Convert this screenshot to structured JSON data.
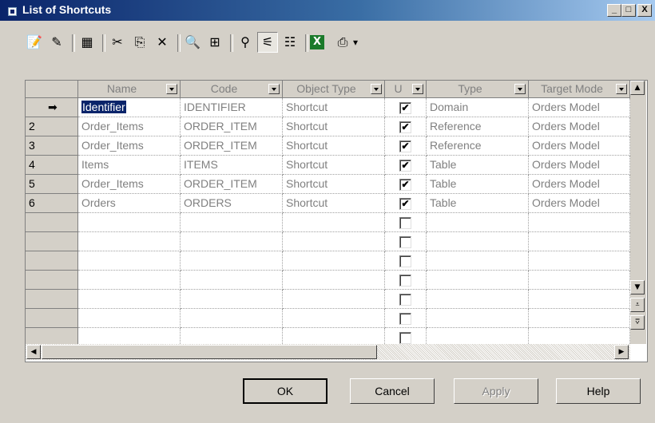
{
  "window": {
    "title": "List of Shortcuts",
    "controls": {
      "minimize": "_",
      "maximize": "□",
      "close": "X"
    }
  },
  "toolbar": [
    {
      "name": "properties-icon",
      "glyph": "📝"
    },
    {
      "name": "edit-icon",
      "glyph": "✎"
    },
    {
      "name": "insert-row-icon",
      "glyph": "▦"
    },
    {
      "name": "cut-icon",
      "glyph": "✂"
    },
    {
      "name": "copy-icon",
      "glyph": "⎘"
    },
    {
      "name": "delete-icon",
      "glyph": "✕"
    },
    {
      "name": "find-icon",
      "glyph": "🔍"
    },
    {
      "name": "find-in-diagram-icon",
      "glyph": "⊞"
    },
    {
      "name": "filter-icon",
      "glyph": "⚲"
    },
    {
      "name": "enable-filter-icon",
      "glyph": "⚟"
    },
    {
      "name": "customize-columns-icon",
      "glyph": "☷"
    },
    {
      "name": "export-excel-icon",
      "glyph": "X"
    },
    {
      "name": "print-icon",
      "glyph": "⎙"
    },
    {
      "name": "print-dropdown-icon",
      "glyph": "▾"
    }
  ],
  "grid": {
    "columns": [
      "Name",
      "Code",
      "Object Type",
      "U",
      "Type",
      "Target Mode"
    ],
    "rows": [
      {
        "num": "",
        "name": "Identifier",
        "code": "IDENTIFIER",
        "object_type": "Shortcut",
        "checked": true,
        "type": "Domain",
        "target_model": "Orders Model"
      },
      {
        "num": "2",
        "name": "Order_Items",
        "code": "ORDER_ITEM",
        "object_type": "Shortcut",
        "checked": true,
        "type": "Reference",
        "target_model": "Orders Model"
      },
      {
        "num": "3",
        "name": "Order_Items",
        "code": "ORDER_ITEM",
        "object_type": "Shortcut",
        "checked": true,
        "type": "Reference",
        "target_model": "Orders Model"
      },
      {
        "num": "4",
        "name": "Items",
        "code": "ITEMS",
        "object_type": "Shortcut",
        "checked": true,
        "type": "Table",
        "target_model": "Orders Model"
      },
      {
        "num": "5",
        "name": "Order_Items",
        "code": "ORDER_ITEM",
        "object_type": "Shortcut",
        "checked": true,
        "type": "Table",
        "target_model": "Orders Model"
      },
      {
        "num": "6",
        "name": "Orders",
        "code": "ORDERS",
        "object_type": "Shortcut",
        "checked": true,
        "type": "Table",
        "target_model": "Orders Model"
      }
    ],
    "empty_rows": 7,
    "current_row_marker": "➡"
  },
  "buttons": {
    "ok": "OK",
    "cancel": "Cancel",
    "apply": "Apply",
    "help": "Help"
  }
}
